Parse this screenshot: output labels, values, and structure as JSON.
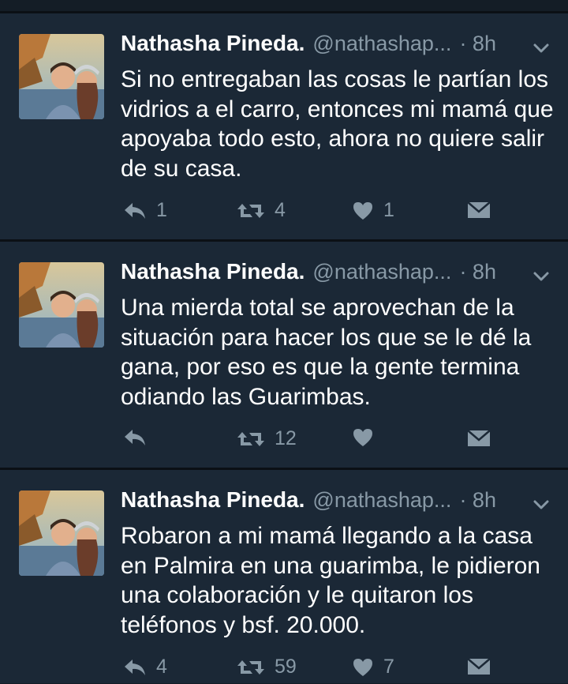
{
  "colors": {
    "background": "#1b2836",
    "divider": "#0b1015",
    "text": "#ffffff",
    "muted": "#8899a6"
  },
  "tweets": [
    {
      "name": "Nathasha Pineda.",
      "handle": "@nathashap...",
      "time": "· 8h",
      "text": "Si no entregaban las cosas le partían los vidrios a el carro, entonces mi mamá que apoyaba todo esto, ahora no quiere salir de su casa.",
      "reply_count": "1",
      "retweet_count": "4",
      "like_count": "1"
    },
    {
      "name": "Nathasha Pineda.",
      "handle": "@nathashap...",
      "time": "· 8h",
      "text": "Una mierda total se aprovechan de la situación para hacer los que se le dé la gana, por eso es que la gente termina odiando las Guarimbas.",
      "reply_count": "",
      "retweet_count": "12",
      "like_count": ""
    },
    {
      "name": "Nathasha Pineda.",
      "handle": "@nathashap...",
      "time": "· 8h",
      "text": "Robaron a mi mamá llegando a la casa en Palmira en una guarimba, le pidieron una colaboración y le quitaron los teléfonos y bsf. 20.000.",
      "reply_count": "4",
      "retweet_count": "59",
      "like_count": "7"
    }
  ],
  "icons": {
    "avatar": "profile-photo",
    "menu": "chevron-down-icon",
    "reply": "reply-icon",
    "retweet": "retweet-icon",
    "like": "heart-icon",
    "message": "envelope-icon"
  }
}
